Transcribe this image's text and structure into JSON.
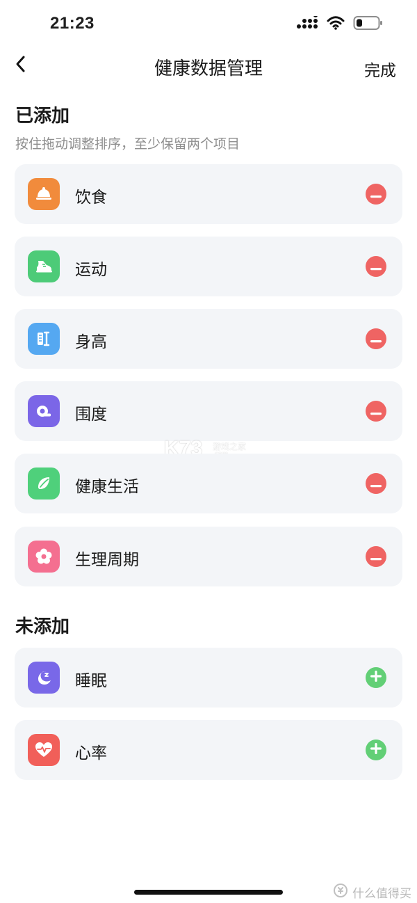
{
  "status_bar": {
    "time": "21:23",
    "icons": [
      "signal-icon",
      "wifi-icon",
      "battery-icon"
    ]
  },
  "header": {
    "back_icon": "chevron-left-icon",
    "title": "健康数据管理",
    "done_label": "完成"
  },
  "added_section": {
    "title": "已添加",
    "subtitle": "按住拖动调整排序，至少保留两个项目",
    "items": [
      {
        "label": "饮食",
        "icon": "food-cover-icon",
        "color": "#f18b3c"
      },
      {
        "label": "运动",
        "icon": "sneaker-icon",
        "color": "#4dcb78"
      },
      {
        "label": "身高",
        "icon": "ruler-icon",
        "color": "#55a8f1"
      },
      {
        "label": "围度",
        "icon": "tape-measure-icon",
        "color": "#7b66e7"
      },
      {
        "label": "健康生活",
        "icon": "leaf-icon",
        "color": "#4fd07b"
      },
      {
        "label": "生理周期",
        "icon": "flower-icon",
        "color": "#f46f90"
      }
    ]
  },
  "not_added_section": {
    "title": "未添加",
    "items": [
      {
        "label": "睡眠",
        "icon": "moon-sleep-icon",
        "color": "#7968e8"
      },
      {
        "label": "心率",
        "icon": "heart-rate-icon",
        "color": "#f15f59"
      }
    ]
  },
  "watermark": {
    "logo": "K73",
    "cn": "游戏之家",
    "url": ".com"
  },
  "bottom_brand": {
    "text": "什么值得买"
  },
  "colors": {
    "card_background": "#f3f5f8",
    "remove_button": "#ef6463",
    "add_button": "#62cf76",
    "subtitle_text": "#8e8e8e"
  }
}
